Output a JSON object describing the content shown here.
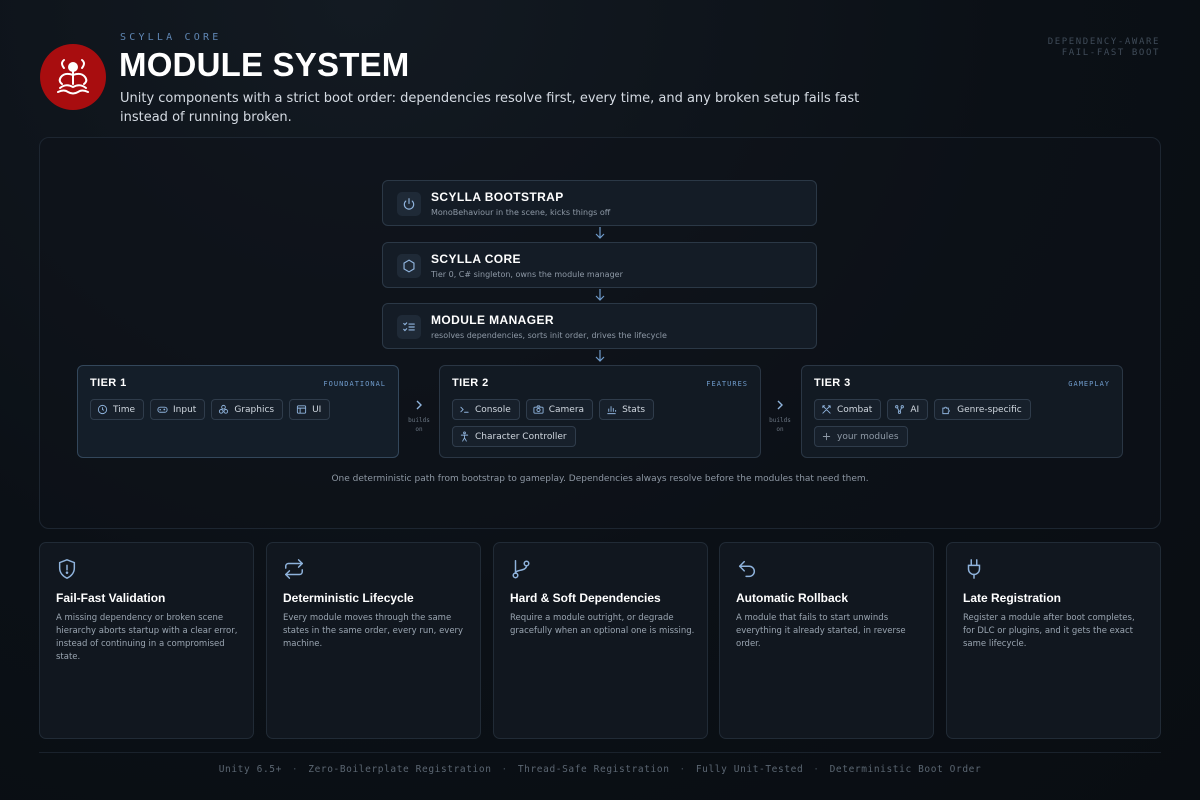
{
  "header": {
    "eyebrow": "SCYLLA CORE",
    "title": "MODULE SYSTEM",
    "subtitle": "Unity components with a strict boot order: dependencies resolve first, every time, and any broken setup fails fast instead of running broken.",
    "top_right_line1": "DEPENDENCY-AWARE",
    "top_right_line2": "FAIL-FAST BOOT",
    "logo_icon": "creature-emblem-icon"
  },
  "colors": {
    "accent_blue": "#6f9bcb",
    "logo_red": "#a80d0f",
    "background": "#0b1016"
  },
  "chain": [
    {
      "title": "SCYLLA BOOTSTRAP",
      "subtitle": "MonoBehaviour in the scene, kicks things off",
      "icon": "power-icon"
    },
    {
      "title": "SCYLLA CORE",
      "subtitle": "Tier 0, C# singleton, owns the module manager",
      "icon": "hexagon-icon"
    },
    {
      "title": "MODULE MANAGER",
      "subtitle": "resolves dependencies, sorts init order, drives the lifecycle",
      "icon": "checklist-icon"
    }
  ],
  "tiers": [
    {
      "name": "TIER 1",
      "tag": "FOUNDATIONAL",
      "modules": [
        {
          "label": "Time",
          "icon": "clock-icon"
        },
        {
          "label": "Input",
          "icon": "gamepad-icon"
        },
        {
          "label": "Graphics",
          "icon": "shapes-icon"
        },
        {
          "label": "UI",
          "icon": "layout-icon"
        }
      ]
    },
    {
      "name": "TIER 2",
      "tag": "FEATURES",
      "modules": [
        {
          "label": "Console",
          "icon": "terminal-icon"
        },
        {
          "label": "Camera",
          "icon": "camera-icon"
        },
        {
          "label": "Stats",
          "icon": "bar-chart-icon"
        },
        {
          "label": "Character Controller",
          "icon": "person-icon"
        }
      ]
    },
    {
      "name": "TIER 3",
      "tag": "GAMEPLAY",
      "modules": [
        {
          "label": "Combat",
          "icon": "crossed-swords-icon"
        },
        {
          "label": "AI",
          "icon": "network-icon"
        },
        {
          "label": "Genre-specific",
          "icon": "puzzle-icon"
        },
        {
          "label": "your modules",
          "icon": "plus-icon"
        }
      ]
    }
  ],
  "builds_on": {
    "line1": "builds",
    "line2": "on"
  },
  "caption": "One deterministic path from bootstrap to gameplay. Dependencies always resolve before the modules that need them.",
  "features": [
    {
      "title": "Fail-Fast Validation",
      "body": "A missing dependency or broken scene hierarchy aborts startup with a clear error, instead of continuing in a compromised state.",
      "icon": "shield-alert-icon"
    },
    {
      "title": "Deterministic Lifecycle",
      "body": "Every module moves through the same states in the same order, every run, every machine.",
      "icon": "repeat-icon"
    },
    {
      "title": "Hard & Soft Dependencies",
      "body": "Require a module outright, or degrade gracefully when an optional one is missing.",
      "icon": "git-branch-icon"
    },
    {
      "title": "Automatic Rollback",
      "body": "A module that fails to start unwinds everything it already started, in reverse order.",
      "icon": "undo-icon"
    },
    {
      "title": "Late Registration",
      "body": "Register a module after boot completes, for DLC or plugins, and it gets the exact same lifecycle.",
      "icon": "plug-icon"
    }
  ],
  "footer": [
    "Unity 6.5+",
    "Zero-Boilerplate Registration",
    "Thread-Safe Registration",
    "Fully Unit-Tested",
    "Deterministic Boot Order"
  ]
}
